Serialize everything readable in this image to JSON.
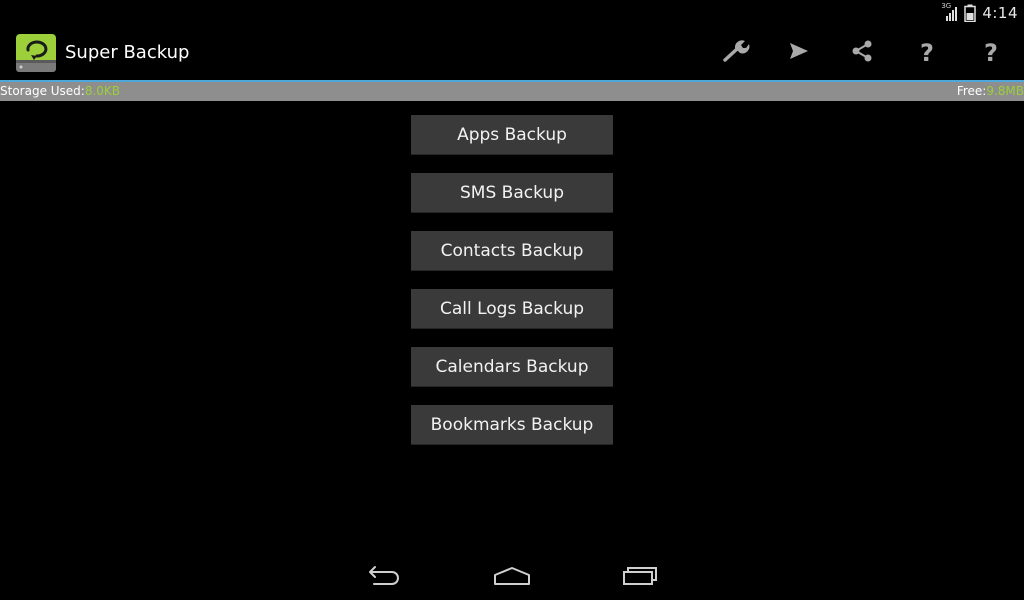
{
  "status_bar": {
    "network_type": "3G",
    "time": "4:14"
  },
  "app": {
    "title": "Super Backup",
    "icon": "super-backup-app-icon",
    "accent_color": "#9ccf3a"
  },
  "toolbar": {
    "actions": [
      {
        "icon": "wrench-icon"
      },
      {
        "icon": "send-icon"
      },
      {
        "icon": "share-icon"
      },
      {
        "icon": "help-icon",
        "label": "?"
      },
      {
        "icon": "help-icon",
        "label": "?"
      }
    ]
  },
  "storage": {
    "used_label": "Storage Used:",
    "used_value": "8.0KB",
    "free_label": "Free:",
    "free_value": "9.8MB",
    "bar_color": "#8e8e8e",
    "divider_color": "#4ea8d9"
  },
  "backups": {
    "apps": "Apps Backup",
    "sms": "SMS Backup",
    "contacts": "Contacts Backup",
    "call_logs": "Call Logs Backup",
    "calendars": "Calendars Backup",
    "bookmarks": "Bookmarks Backup"
  },
  "nav": {
    "buttons": [
      "back-icon",
      "home-icon",
      "recent-apps-icon"
    ]
  }
}
